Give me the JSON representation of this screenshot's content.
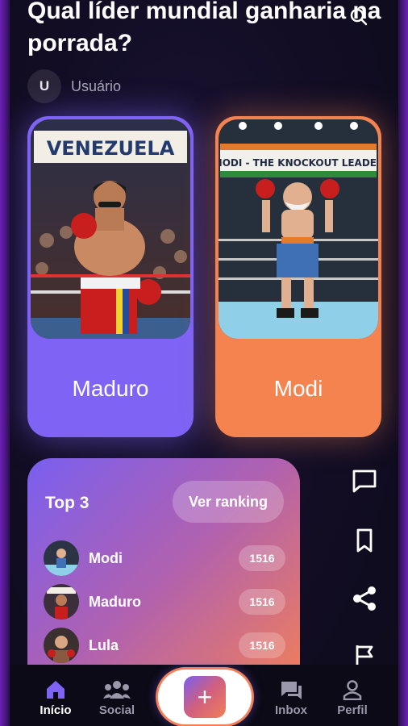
{
  "post": {
    "title": "Qual líder mundial ganharia na porrada?",
    "author_initial": "U",
    "author_name": "Usuário"
  },
  "options": [
    {
      "label": "Maduro",
      "banner": "VENEZUELA",
      "color": "#7e63f5"
    },
    {
      "label": "Modi",
      "banner": "MODI - THE KNOCKOUT LEADER",
      "color": "#f4834f"
    }
  ],
  "ranking": {
    "title": "Top 3",
    "button_label": "Ver ranking",
    "items": [
      {
        "name": "Modi",
        "score": "1516"
      },
      {
        "name": "Maduro",
        "score": "1516"
      },
      {
        "name": "Lula",
        "score": "1516"
      }
    ]
  },
  "side_actions": [
    "comment-icon",
    "bookmark-icon",
    "share-icon",
    "flag-icon"
  ],
  "tabs": {
    "home": "Início",
    "social": "Social",
    "inbox": "Inbox",
    "profile": "Perfil",
    "create": "+"
  }
}
